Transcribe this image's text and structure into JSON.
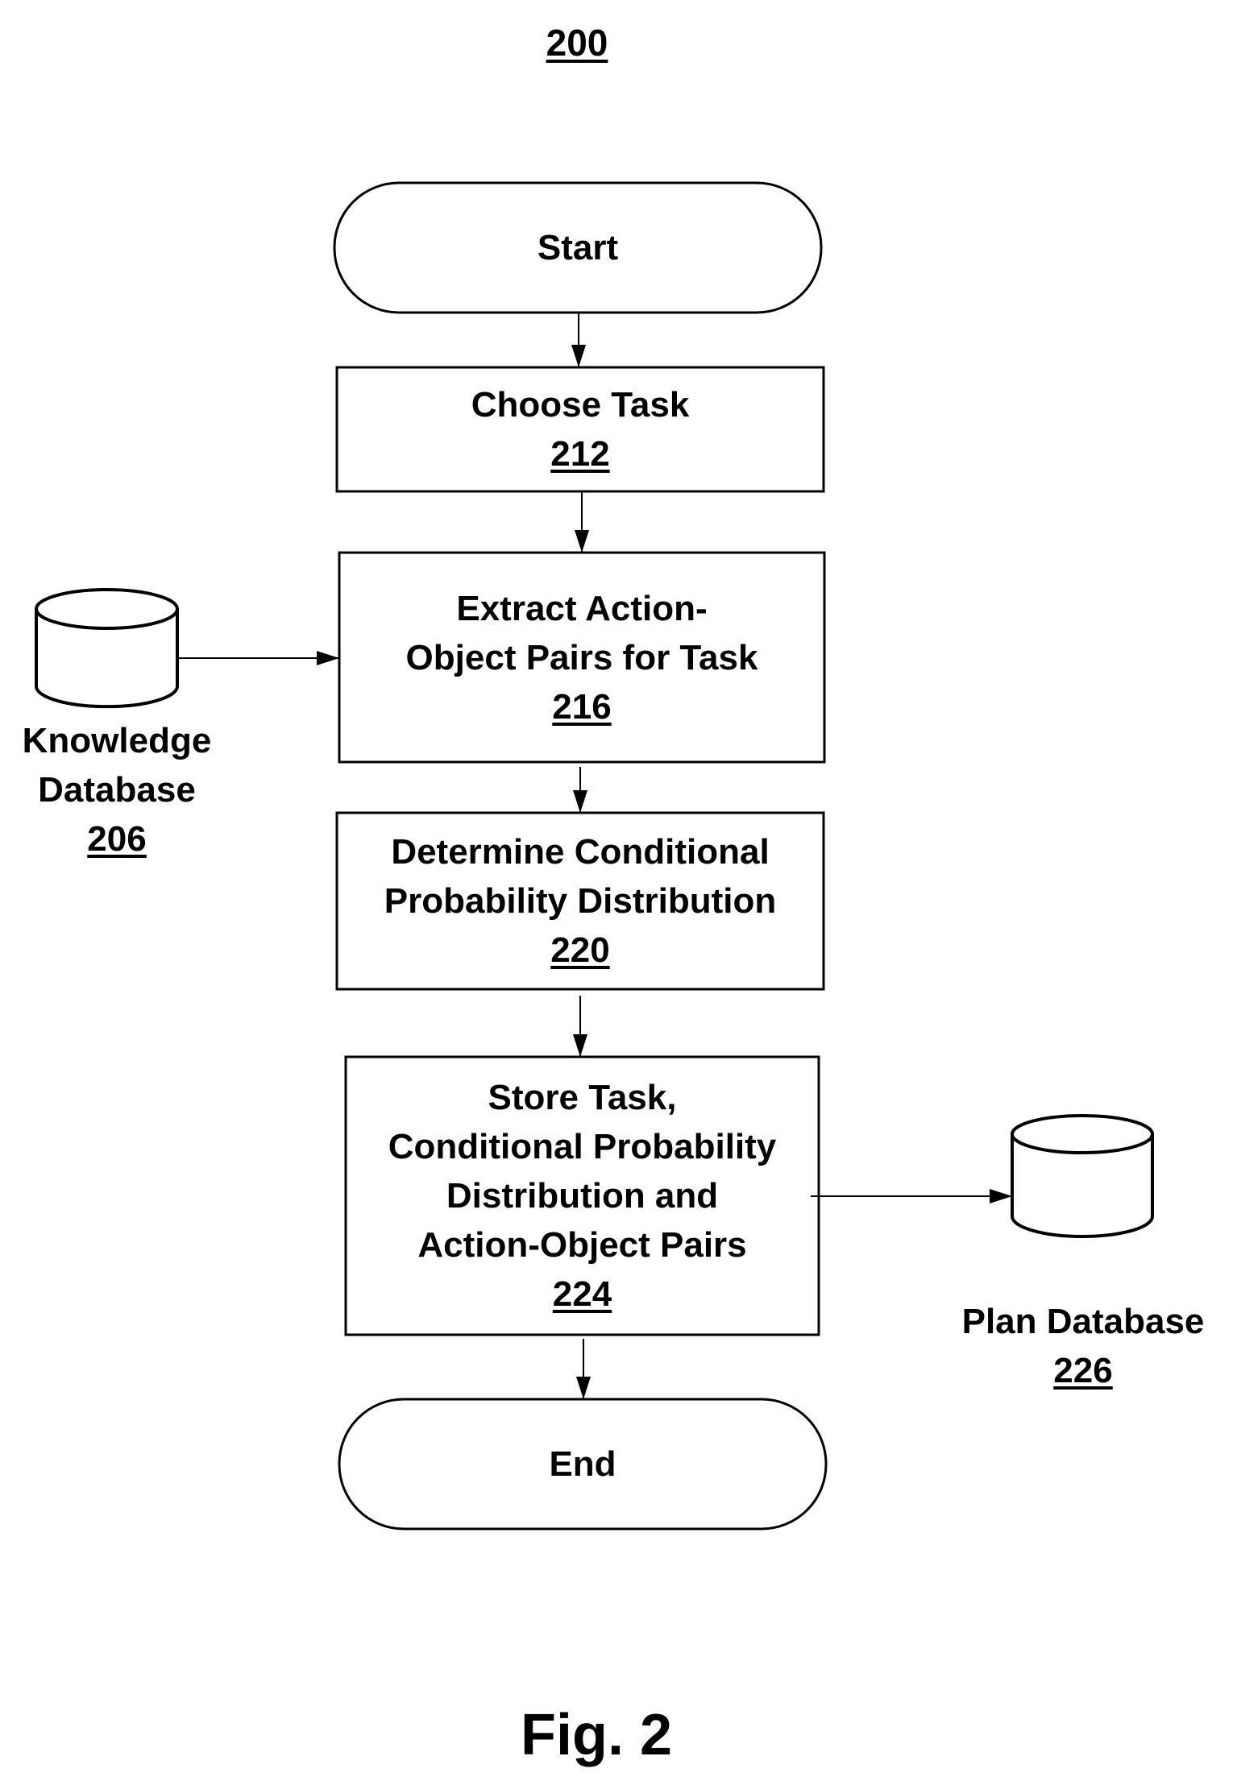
{
  "figure": {
    "ref_number": "200",
    "caption": "Fig. 2"
  },
  "nodes": {
    "start": {
      "label": "Start"
    },
    "choose_task": {
      "lines": [
        "Choose Task"
      ],
      "ref": "212"
    },
    "extract": {
      "lines": [
        "Extract Action-",
        "Object Pairs for Task"
      ],
      "ref": "216"
    },
    "determine": {
      "lines": [
        "Determine Conditional",
        "Probability Distribution"
      ],
      "ref": "220"
    },
    "store": {
      "lines": [
        "Store Task,",
        "Conditional Probability",
        "Distribution and",
        "Action-Object Pairs"
      ],
      "ref": "224"
    },
    "end": {
      "label": "End"
    }
  },
  "databases": {
    "knowledge": {
      "lines": [
        "Knowledge",
        "Database"
      ],
      "ref": "206"
    },
    "plan": {
      "lines": [
        "Plan Database"
      ],
      "ref": "226"
    }
  },
  "edges": [
    {
      "from": "start",
      "to": "choose_task"
    },
    {
      "from": "choose_task",
      "to": "extract"
    },
    {
      "from": "knowledge",
      "to": "extract"
    },
    {
      "from": "extract",
      "to": "determine"
    },
    {
      "from": "determine",
      "to": "store"
    },
    {
      "from": "store",
      "to": "plan"
    },
    {
      "from": "store",
      "to": "end"
    }
  ]
}
